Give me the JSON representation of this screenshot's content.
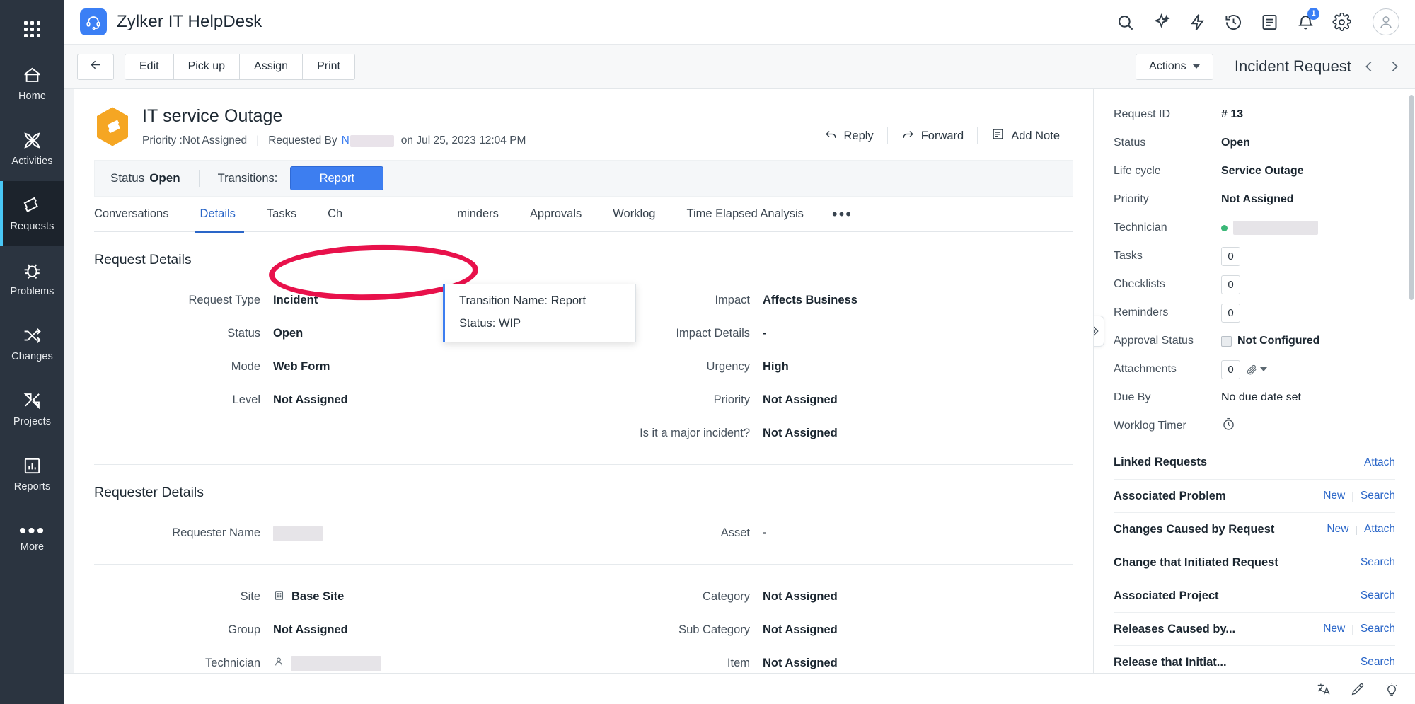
{
  "app": {
    "title": "Zylker IT HelpDesk",
    "logo_icon": "headset-icon"
  },
  "sidebar": {
    "grid_icon": "apps-grid-icon",
    "items": [
      {
        "label": "Home",
        "icon": "home-icon",
        "active": false
      },
      {
        "label": "Activities",
        "icon": "activities-icon",
        "active": false
      },
      {
        "label": "Requests",
        "icon": "ticket-icon",
        "active": true
      },
      {
        "label": "Problems",
        "icon": "bug-icon",
        "active": false
      },
      {
        "label": "Changes",
        "icon": "shuffle-icon",
        "active": false
      },
      {
        "label": "Projects",
        "icon": "projects-icon",
        "active": false
      },
      {
        "label": "Reports",
        "icon": "chart-icon",
        "active": false
      },
      {
        "label": "More",
        "icon": "ellipsis-icon",
        "active": false
      }
    ]
  },
  "header": {
    "icons": [
      "search-icon",
      "sparkle-icon",
      "flash-icon",
      "history-icon",
      "tasks-icon",
      "bell-icon",
      "gear-icon"
    ],
    "notification_count": "1",
    "avatar": "user-avatar"
  },
  "toolbar": {
    "back_icon": "arrow-left-icon",
    "buttons": [
      "Edit",
      "Pick up",
      "Assign",
      "Print"
    ],
    "actions_label": "Actions",
    "module_title": "Incident Request",
    "prev_icon": "chevron-left-icon",
    "next_icon": "chevron-right-icon"
  },
  "ticket": {
    "icon": "ticket-hex-icon",
    "title": "IT service Outage",
    "priority_label": "Priority :Not Assigned",
    "requested_by_label": "Requested By",
    "requested_by_value": "",
    "requested_on": "on Jul 25, 2023 12:04 PM",
    "actions": [
      {
        "label": "Reply",
        "icon": "reply-icon"
      },
      {
        "label": "Forward",
        "icon": "forward-icon"
      },
      {
        "label": "Add Note",
        "icon": "note-icon"
      }
    ]
  },
  "status_strip": {
    "status_label": "Status",
    "status_value": "Open",
    "transitions_label": "Transitions:",
    "transition_button": "Report"
  },
  "tooltip": {
    "line1": "Transition Name: Report",
    "line2": "Status: WIP"
  },
  "tabs": {
    "items": [
      {
        "label": "Conversations",
        "active": false
      },
      {
        "label": "Details",
        "active": true
      },
      {
        "label": "Tasks",
        "active": false
      },
      {
        "label": "Ch",
        "active": false
      },
      {
        "label": "minders",
        "active": false
      },
      {
        "label": "Approvals",
        "active": false
      },
      {
        "label": "Worklog",
        "active": false
      },
      {
        "label": "Time Elapsed Analysis",
        "active": false
      }
    ],
    "more_icon": "ellipsis-icon"
  },
  "request_details": {
    "section_title": "Request Details",
    "left": [
      {
        "label": "Request Type",
        "value": "Incident"
      },
      {
        "label": "Status",
        "value": "Open"
      },
      {
        "label": "Mode",
        "value": "Web Form"
      },
      {
        "label": "Level",
        "value": "Not Assigned"
      }
    ],
    "right": [
      {
        "label": "Impact",
        "value": "Affects Business"
      },
      {
        "label": "Impact Details",
        "value": "-"
      },
      {
        "label": "Urgency",
        "value": "High"
      },
      {
        "label": "Priority",
        "value": "Not Assigned"
      },
      {
        "label": "Is it a major incident?",
        "value": "Not Assigned"
      }
    ]
  },
  "requester_details": {
    "section_title": "Requester Details",
    "left_top": [
      {
        "label": "Requester Name",
        "value": "",
        "redacted": true
      }
    ],
    "right_top": [
      {
        "label": "Asset",
        "value": "-"
      }
    ],
    "left": [
      {
        "label": "Site",
        "value": "Base Site",
        "icon": "building-icon"
      },
      {
        "label": "Group",
        "value": "Not Assigned"
      },
      {
        "label": "Technician",
        "value": "",
        "icon": "user-icon",
        "redacted": true
      }
    ],
    "right": [
      {
        "label": "Category",
        "value": "Not Assigned"
      },
      {
        "label": "Sub Category",
        "value": "Not Assigned"
      },
      {
        "label": "Item",
        "value": "Not Assigned"
      }
    ]
  },
  "properties": {
    "rows": [
      {
        "label": "Request ID",
        "value": "# 13",
        "type": "text"
      },
      {
        "label": "Status",
        "value": "Open",
        "type": "text"
      },
      {
        "label": "Life cycle",
        "value": "Service Outage",
        "type": "text"
      },
      {
        "label": "Priority",
        "value": "Not Assigned",
        "type": "text"
      },
      {
        "label": "Technician",
        "value": "",
        "type": "redacted-tech"
      },
      {
        "label": "Tasks",
        "value": "0",
        "type": "count"
      },
      {
        "label": "Checklists",
        "value": "0",
        "type": "count"
      },
      {
        "label": "Reminders",
        "value": "0",
        "type": "count"
      },
      {
        "label": "Approval Status",
        "value": "Not Configured",
        "type": "checkbox"
      },
      {
        "label": "Attachments",
        "value": "0",
        "type": "attach"
      },
      {
        "label": "Due By",
        "value": "No due date set",
        "type": "text-normal"
      },
      {
        "label": "Worklog Timer",
        "value": "",
        "type": "timer"
      }
    ],
    "linked_header": {
      "title": "Linked Requests",
      "action": "Attach"
    },
    "linked_rows": [
      {
        "name": "Associated Problem",
        "actions": [
          "New",
          "Search"
        ]
      },
      {
        "name": "Changes Caused by Request",
        "actions": [
          "New",
          "Attach"
        ]
      },
      {
        "name": "Change that Initiated Request",
        "actions": [
          "Search"
        ]
      },
      {
        "name": "Associated Project",
        "actions": [
          "Search"
        ]
      },
      {
        "name": "Releases Caused by...",
        "actions": [
          "New",
          "Search"
        ]
      },
      {
        "name": "Release that Initiat...",
        "actions": [
          "Search"
        ]
      }
    ],
    "collapse_icon": "chevron-double-right-icon"
  },
  "bottombar": {
    "icons": [
      "translate-icon",
      "compose-icon",
      "bulb-icon"
    ]
  },
  "colors": {
    "accent_blue": "#3d7ef0",
    "link_blue": "#2a66c8",
    "annotation_red": "#e8114b",
    "rail_bg": "#2b3440",
    "rail_active": "#1c232c",
    "rail_marker": "#49c7f5",
    "ticket_orange": "#f5a623",
    "status_green": "#3cb878"
  }
}
